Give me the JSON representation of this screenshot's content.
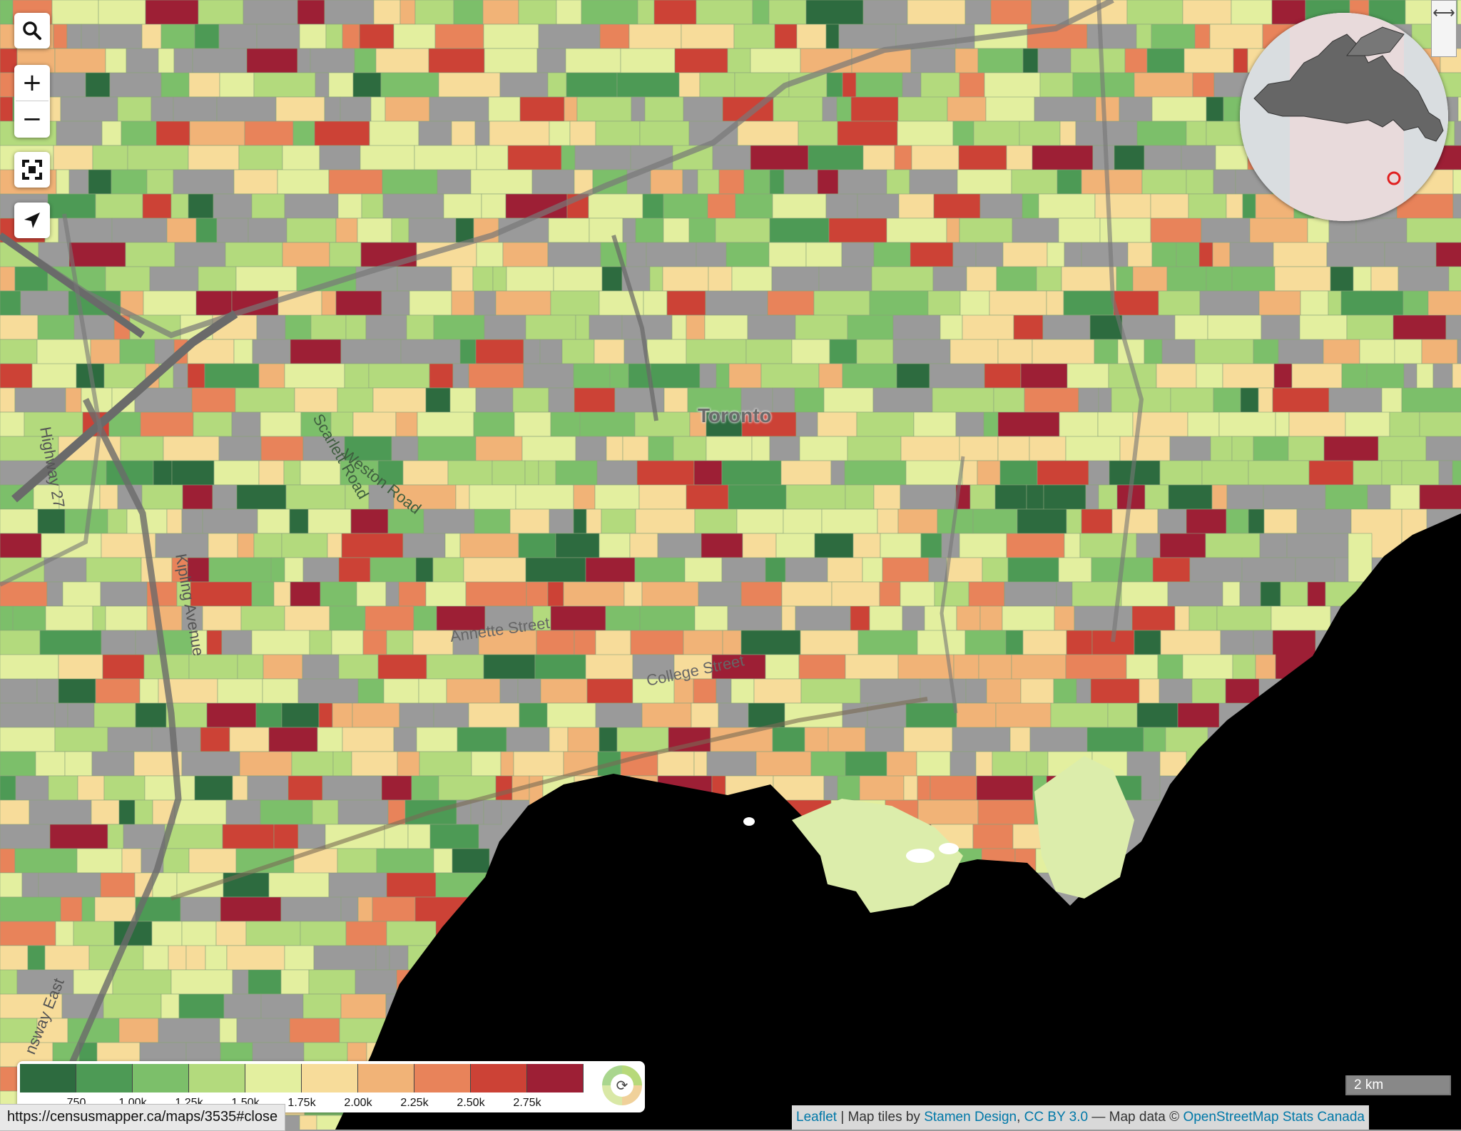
{
  "controls": {
    "search_icon": "search-icon",
    "zoom_in_label": "+",
    "zoom_out_label": "−",
    "fullscreen_icon": "fullscreen-icon",
    "locate_icon": "locate-arrow-icon"
  },
  "map": {
    "labels": {
      "city": "Toronto",
      "highway27": "Highway 27",
      "kipling": "Kipling Avenue",
      "weston": "Weston Road",
      "scarlett": "Scarlett Road",
      "annette": "Annette Street",
      "college": "College Street",
      "queensway": "nsway East"
    },
    "colors": {
      "land_nodata": "#9a9a9a",
      "water": "#000000",
      "park": "#d9e8a6"
    }
  },
  "legend": {
    "colors": [
      "#2d6b3f",
      "#4d9a55",
      "#7cbf6a",
      "#b3da7d",
      "#e3ef9f",
      "#f7dc9a",
      "#f1b377",
      "#e8835a",
      "#cc4236",
      "#9d1f35"
    ],
    "ticks": [
      "750",
      "1.00k",
      "1.25k",
      "1.50k",
      "1.75k",
      "2.00k",
      "2.25k",
      "2.50k",
      "2.75k"
    ],
    "refresh_icon": "refresh-icon"
  },
  "status_url": "https://censusmapper.ca/maps/3535#close",
  "scale_label": "2 km",
  "attribution": {
    "leaflet": "Leaflet",
    "sep1": " | Map tiles by ",
    "stamen": "Stamen Design",
    "sep2": ", ",
    "ccby": "CC BY 3.0",
    "sep3": " — Map data © ",
    "osm": "OpenStreetMap",
    "sep4": " ",
    "statcan": "Stats Canada"
  },
  "minimap": {
    "toggle_icon": "⟷"
  }
}
